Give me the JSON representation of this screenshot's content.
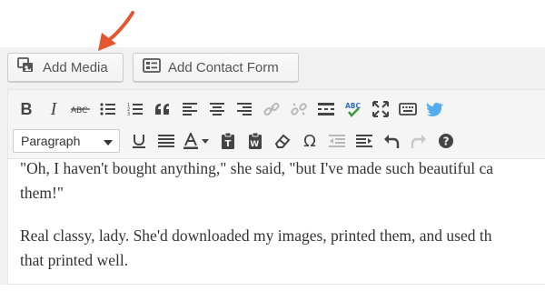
{
  "media_buttons": {
    "add_media_label": "Add Media",
    "add_contact_form_label": "Add Contact Form"
  },
  "annotation": {
    "arrow_color": "#e8542e"
  },
  "toolbar": {
    "row1_icons": [
      "bold-icon",
      "italic-icon",
      "strikethrough-icon",
      "bulleted-list-icon",
      "numbered-list-icon",
      "blockquote-icon",
      "align-left-icon",
      "align-center-icon",
      "align-right-icon",
      "insert-link-icon",
      "remove-link-icon",
      "read-more-icon",
      "spellcheck-icon",
      "fullscreen-icon",
      "toolbar-toggle-icon",
      "twitter-icon"
    ],
    "format_select": {
      "selected": "Paragraph",
      "options": [
        "Paragraph"
      ]
    },
    "row2_icons": [
      "underline-icon",
      "justify-icon",
      "text-color-icon",
      "paste-as-text-icon",
      "paste-from-word-icon",
      "clear-formatting-icon",
      "special-character-icon",
      "outdent-icon",
      "indent-icon",
      "undo-icon",
      "redo-icon",
      "help-icon"
    ],
    "colors": {
      "icon": "#444444",
      "disabled": "#b8b8b8",
      "twitter": "#55acee",
      "spell_blue": "#2f6fc1",
      "spell_green": "#3a9b3a"
    }
  },
  "editor": {
    "paragraphs": [
      {
        "lines": [
          "\"Oh, I haven't bought anything,\" she said, \"but I've made such beautiful ca",
          "them!\""
        ]
      },
      {
        "lines": [
          "Real classy, lady. She'd downloaded my images, printed them, and used th",
          "that printed well."
        ]
      }
    ]
  }
}
